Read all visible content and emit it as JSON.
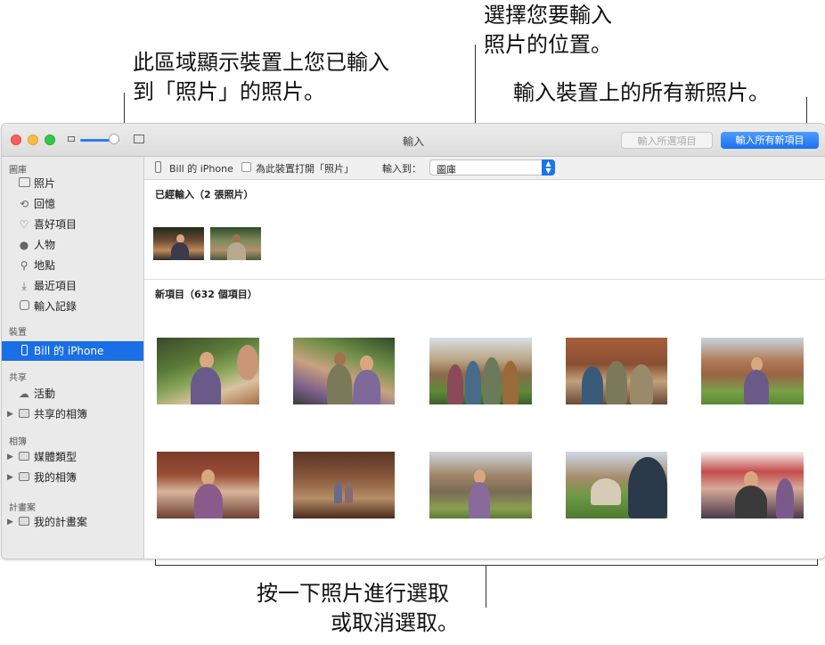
{
  "callouts": {
    "left_line1": "此區域顯示裝置上您已輸入",
    "left_line2": "到「照片」的照片。",
    "top_line1": "選擇您要輸入",
    "top_line2": "照片的位置。",
    "right": "輸入裝置上的所有新照片。",
    "bottom_line1": "按一下照片進行選取",
    "bottom_line2": "或取消選取。"
  },
  "window": {
    "title": "輸入",
    "import_selected_label": "輸入所選項目",
    "import_all_label": "輸入所有新項目"
  },
  "sidebar": {
    "sections": {
      "library": "圖庫",
      "devices": "裝置",
      "shared": "共享",
      "albums": "相簿",
      "projects": "計畫案"
    },
    "library_items": [
      {
        "label": "照片",
        "icon": "photos-icon"
      },
      {
        "label": "回憶",
        "icon": "memories-icon"
      },
      {
        "label": "喜好項目",
        "icon": "heart-icon"
      },
      {
        "label": "人物",
        "icon": "person-icon"
      },
      {
        "label": "地點",
        "icon": "pin-icon"
      },
      {
        "label": "最近項目",
        "icon": "recent-icon"
      },
      {
        "label": "輸入記錄",
        "icon": "camera-icon"
      }
    ],
    "device": "Bill 的 iPhone",
    "shared_items": [
      {
        "label": "活動",
        "icon": "cloud-icon"
      },
      {
        "label": "共享的相簿",
        "icon": "folder-icon"
      }
    ],
    "album_items": [
      {
        "label": "媒體類型",
        "icon": "folder-icon"
      },
      {
        "label": "我的相簿",
        "icon": "folder-icon"
      }
    ],
    "project_items": [
      {
        "label": "我的計畫案",
        "icon": "folder-icon"
      }
    ]
  },
  "toolbar": {
    "device_name": "Bill 的 iPhone",
    "open_photos_label": "為此裝置打開「照片」",
    "open_photos_checked": false,
    "import_to_label": "輸入到：",
    "import_to_value": "圖庫"
  },
  "content": {
    "already_imported_heading": "已經輸入（2 張照片）",
    "new_items_heading": "新項目（632 個項目）"
  }
}
